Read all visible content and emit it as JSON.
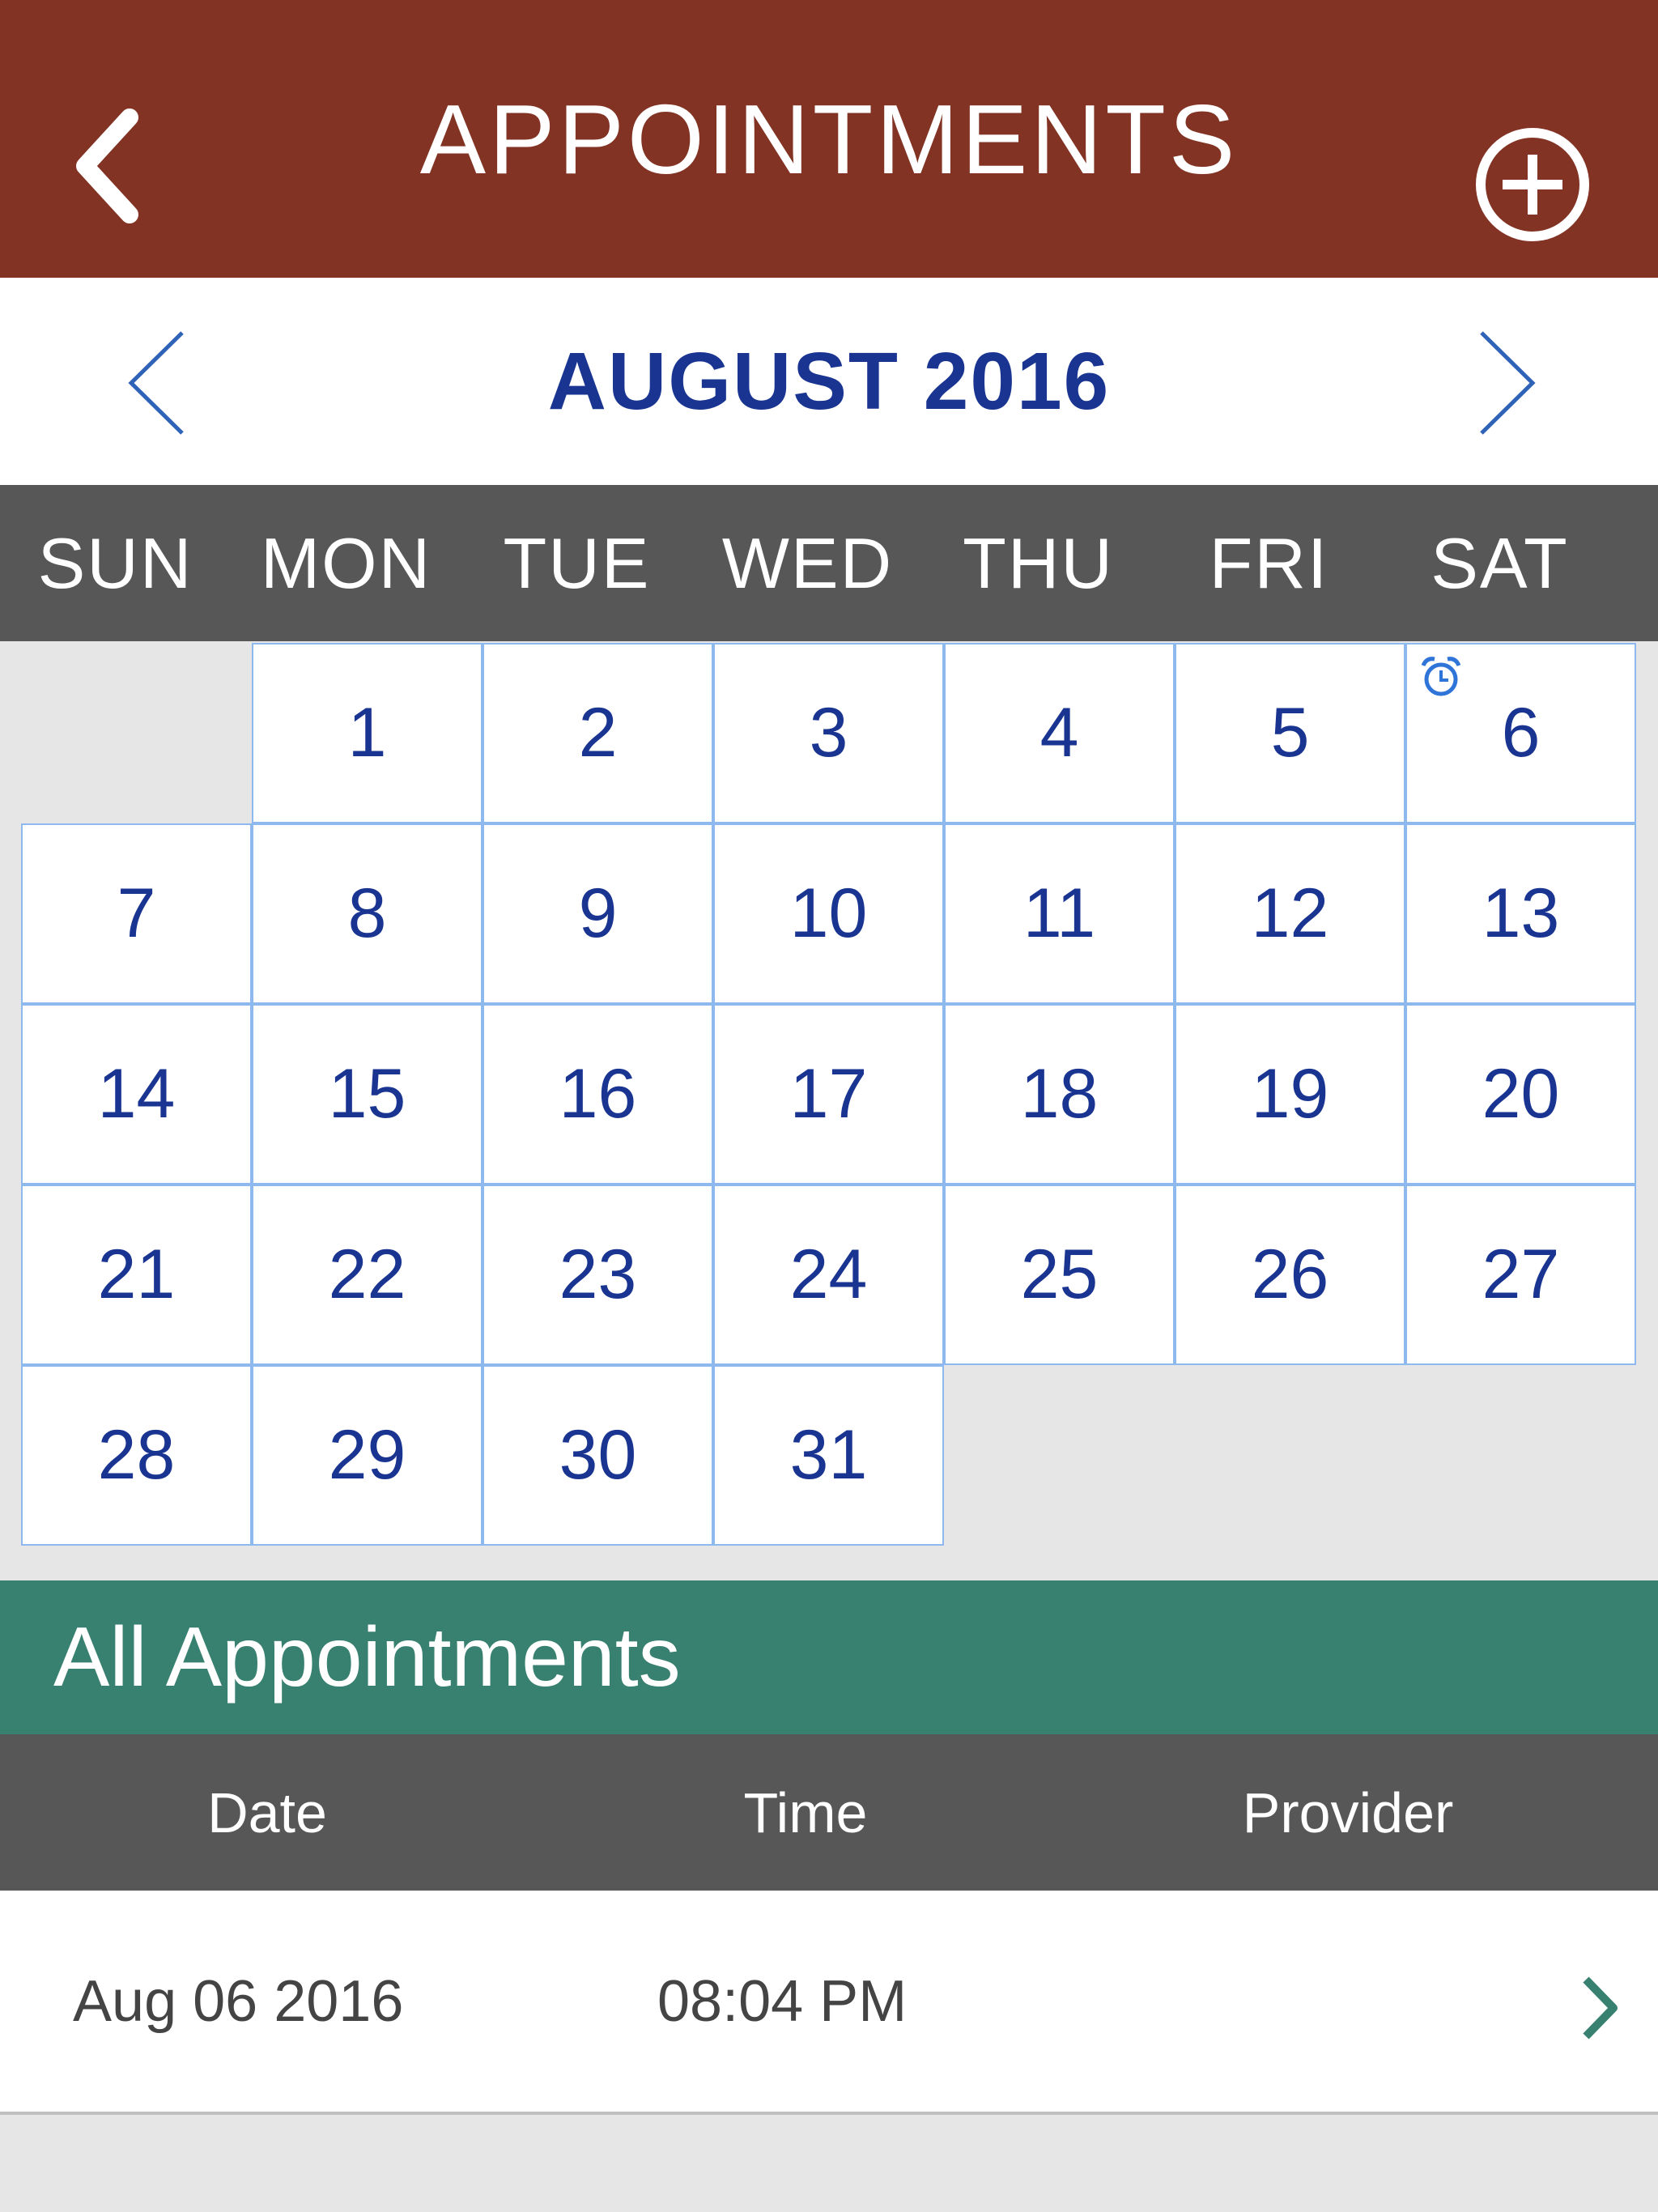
{
  "header": {
    "title": "APPOINTMENTS"
  },
  "calendar": {
    "month_label": "AUGUST 2016",
    "weekdays": [
      "SUN",
      "MON",
      "TUE",
      "WED",
      "THU",
      "FRI",
      "SAT"
    ],
    "days": [
      "1",
      "2",
      "3",
      "4",
      "5",
      "6",
      "7",
      "8",
      "9",
      "10",
      "11",
      "12",
      "13",
      "14",
      "15",
      "16",
      "17",
      "18",
      "19",
      "20",
      "21",
      "22",
      "23",
      "24",
      "25",
      "26",
      "27",
      "28",
      "29",
      "30",
      "31"
    ],
    "appointment_day": "6"
  },
  "appointments": {
    "section_title": "All Appointments",
    "columns": [
      "Date",
      "Time",
      "Provider"
    ],
    "rows": [
      {
        "date": "Aug 06 2016",
        "time": "08:04 PM",
        "provider": ""
      }
    ]
  },
  "colors": {
    "header": "#823324",
    "accent_blue": "#1a3591",
    "section_green": "#388070",
    "bar_gray": "#575757"
  }
}
